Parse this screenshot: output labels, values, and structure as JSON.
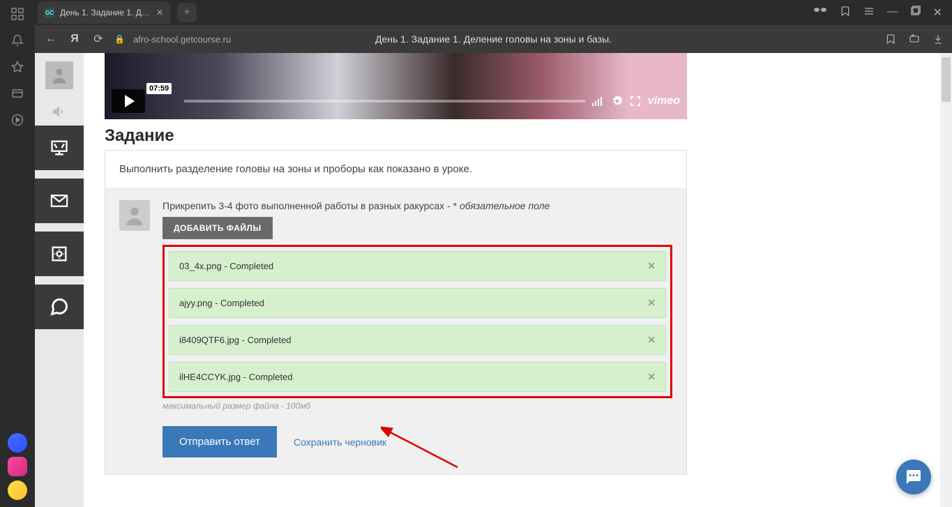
{
  "browser": {
    "tab_title": "День 1. Задание 1. Дел",
    "url": "afro-school.getcourse.ru",
    "page_title": "День 1. Задание 1. Деление головы на зоны и базы."
  },
  "video": {
    "duration": "07:59",
    "provider": "vimeo"
  },
  "task": {
    "heading": "Задание",
    "description": "Выполнить разделение головы на зоны и проборы как показано в уроке.",
    "attach_label_prefix": "Прикрепить 3-4 фото выполненной работы в разных ракурсах - * ",
    "attach_label_em": "обязательное поле",
    "add_files_button": "ДОБАВИТЬ ФАЙЛЫ",
    "file_hint": "максимальный размер файла - 100мб",
    "submit_button": "Отправить ответ",
    "save_draft": "Сохранить черновик"
  },
  "files": [
    {
      "name": "03_4x.png",
      "status": "Completed"
    },
    {
      "name": "ajyy.png",
      "status": "Completed"
    },
    {
      "name": "i8409QTF6.jpg",
      "status": "Completed"
    },
    {
      "name": "ilHE4CCYK.jpg",
      "status": "Completed"
    }
  ]
}
